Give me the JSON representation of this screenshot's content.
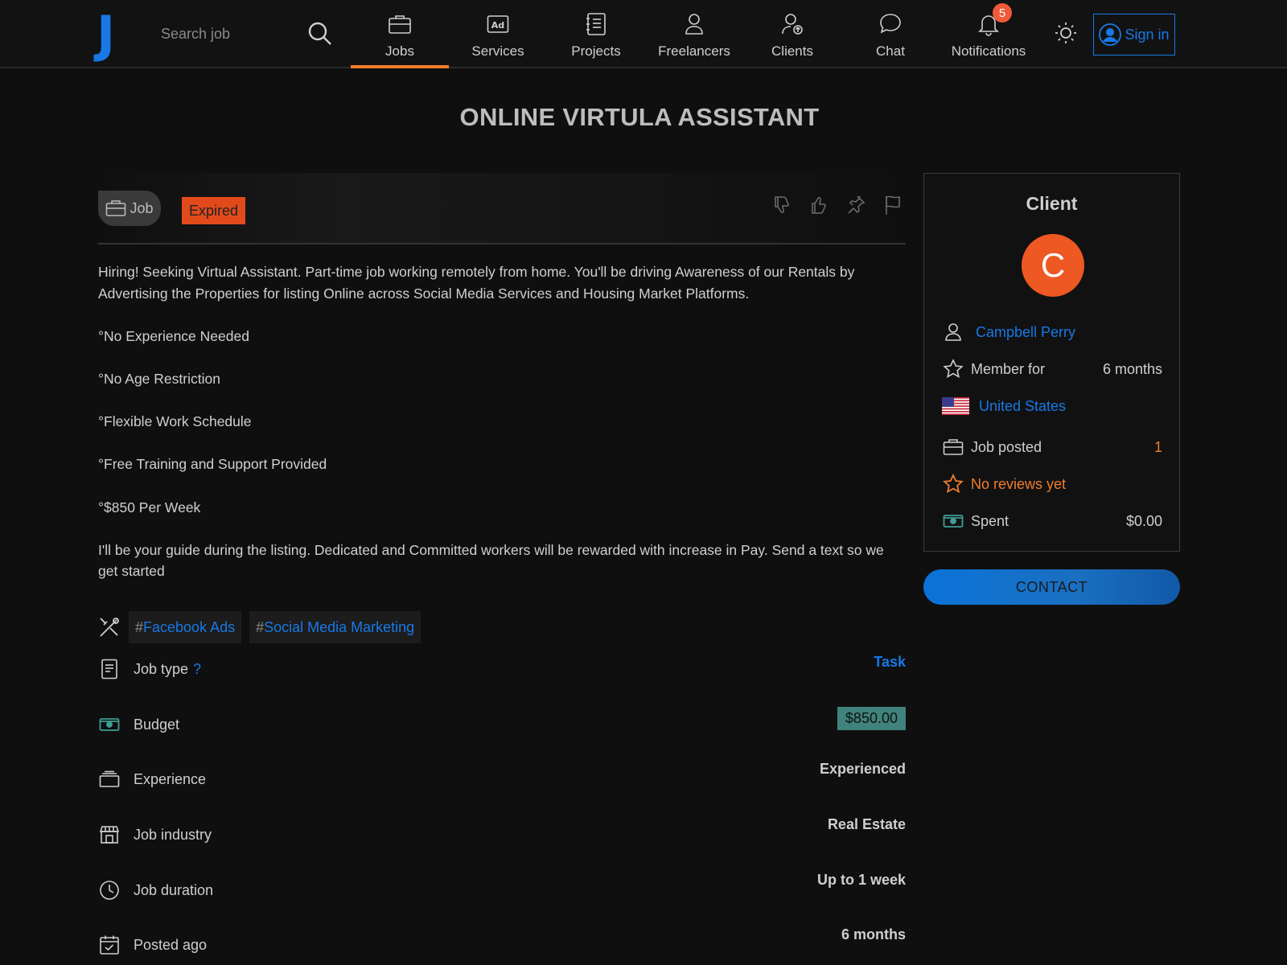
{
  "header": {
    "logo": "J",
    "search_placeholder": "Search job",
    "nav": [
      {
        "label": "Jobs",
        "icon": "briefcase-icon",
        "active": true
      },
      {
        "label": "Services",
        "icon": "ad-icon"
      },
      {
        "label": "Projects",
        "icon": "notebook-icon"
      },
      {
        "label": "Freelancers",
        "icon": "person-icon"
      },
      {
        "label": "Clients",
        "icon": "client-icon"
      },
      {
        "label": "Chat",
        "icon": "chat-bubble-icon"
      },
      {
        "label": "Notifications",
        "icon": "bell-icon",
        "badge": "5"
      }
    ],
    "sign_in": "Sign in"
  },
  "page_title": "ONLINE VIRTULA ASSISTANT",
  "job": {
    "type_label": "Job",
    "status": "Expired",
    "description": [
      "Hiring! Seeking Virtual Assistant. Part-time job working remotely from home. You'll be driving Awareness of our Rentals by Advertising the Properties for listing Online across Social Media Services and Housing Market Platforms.",
      "°No Experience Needed",
      "°No Age Restriction",
      "°Flexible Work Schedule",
      "°Free Training and Support Provided",
      "°$850 Per Week",
      "I'll be your guide during the listing. Dedicated and Committed workers will be rewarded with increase in Pay. Send a text so we get started"
    ],
    "tags": [
      "Facebook Ads",
      "Social Media Marketing"
    ],
    "tag_prefix": "#",
    "details": {
      "job_type": {
        "label": "Job type",
        "help": "?",
        "value": "Task"
      },
      "budget": {
        "label": "Budget",
        "value": "$850.00"
      },
      "experience": {
        "label": "Experience",
        "value": "Experienced"
      },
      "industry": {
        "label": "Job industry",
        "value": "Real Estate"
      },
      "duration": {
        "label": "Job duration",
        "value": "Up to 1 week"
      },
      "posted": {
        "label": "Posted ago",
        "value": "6 months"
      }
    }
  },
  "client": {
    "title": "Client",
    "avatar_letter": "C",
    "name": "Campbell Perry",
    "member_label": "Member for",
    "member_value": "6 months",
    "country": "United States",
    "jobs_posted_label": "Job posted",
    "jobs_posted_value": "1",
    "reviews": "No reviews yet",
    "spent_label": "Spent",
    "spent_value": "$0.00",
    "contact": "CONTACT"
  },
  "colors": {
    "accent": "#1778e6",
    "active_tab": "#ef7d2d",
    "expired": "#e24a1c",
    "avatar": "#ee5822",
    "review_star": "#ef7d2d",
    "budget_bg": "#3f837c"
  }
}
